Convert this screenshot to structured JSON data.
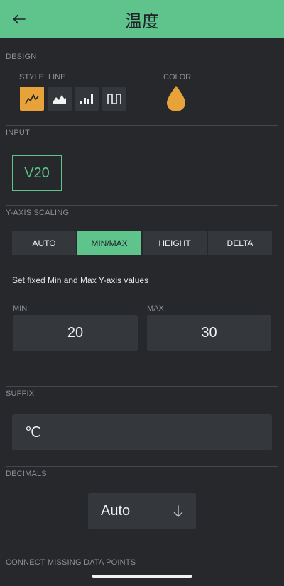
{
  "header": {
    "title": "温度",
    "back_icon": "arrow-left-icon",
    "color": "#5ec48c"
  },
  "design": {
    "section_label": "DESIGN",
    "style_label": "STYLE: LINE",
    "styles": [
      {
        "icon": "line-chart-icon",
        "active": true
      },
      {
        "icon": "area-chart-icon",
        "active": false
      },
      {
        "icon": "bar-chart-icon",
        "active": false
      },
      {
        "icon": "step-chart-icon",
        "active": false
      }
    ],
    "color_label": "COLOR",
    "color_value": "#e8a23a",
    "color_icon": "drop-icon"
  },
  "input": {
    "section_label": "INPUT",
    "pin": "V20"
  },
  "y_axis": {
    "section_label": "Y-AXIS SCALING",
    "options": [
      {
        "label": "AUTO",
        "active": false
      },
      {
        "label": "MIN/MAX",
        "active": true
      },
      {
        "label": "HEIGHT",
        "active": false
      },
      {
        "label": "DELTA",
        "active": false
      }
    ],
    "hint": "Set fixed Min and Max Y-axis values",
    "min_label": "MIN",
    "min_value": "20",
    "max_label": "MAX",
    "max_value": "30"
  },
  "suffix": {
    "section_label": "SUFFIX",
    "value": "℃"
  },
  "decimals": {
    "section_label": "DECIMALS",
    "value": "Auto",
    "icon": "arrow-down-icon"
  },
  "connect": {
    "section_label": "CONNECT MISSING DATA POINTS"
  }
}
